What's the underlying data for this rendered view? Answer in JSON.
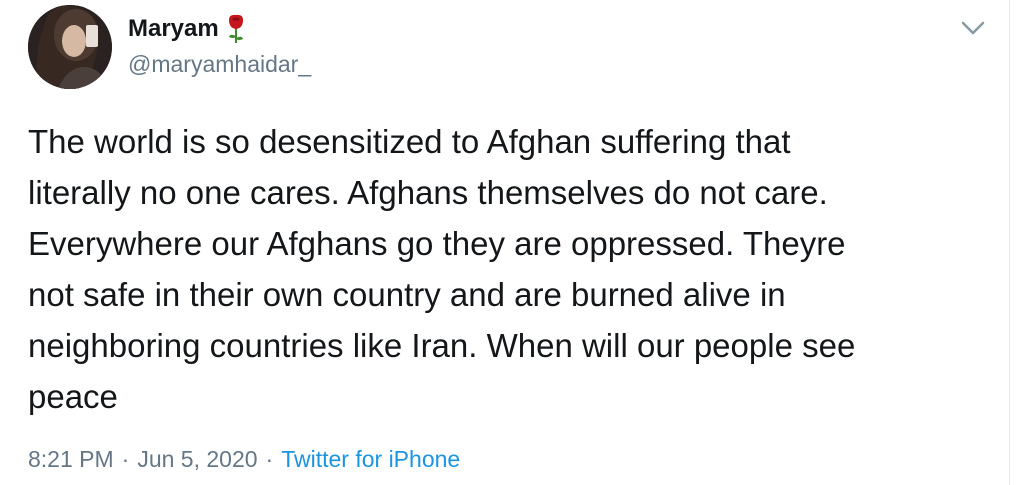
{
  "author": {
    "display_name": "Maryam",
    "name_emoji": "rose-icon",
    "handle": "@maryamhaidar_",
    "avatar": "avatar"
  },
  "menu": {
    "icon": "chevron-down-icon"
  },
  "tweet": {
    "lines": [
      "The world is so desensitized to Afghan suffering that",
      "literally no one cares. Afghans themselves do not care.",
      "Everywhere our Afghans go they are oppressed. Theyre",
      "not safe in their own country and are burned alive in",
      "neighboring countries like Iran. When will our people see",
      "peace"
    ]
  },
  "meta": {
    "time": "8:21 PM",
    "date": "Jun 5, 2020",
    "separator": "·",
    "source": "Twitter for iPhone"
  },
  "colors": {
    "text": "#14171a",
    "secondary": "#657786",
    "link": "#1b95e0",
    "rose": "#c4161c"
  }
}
